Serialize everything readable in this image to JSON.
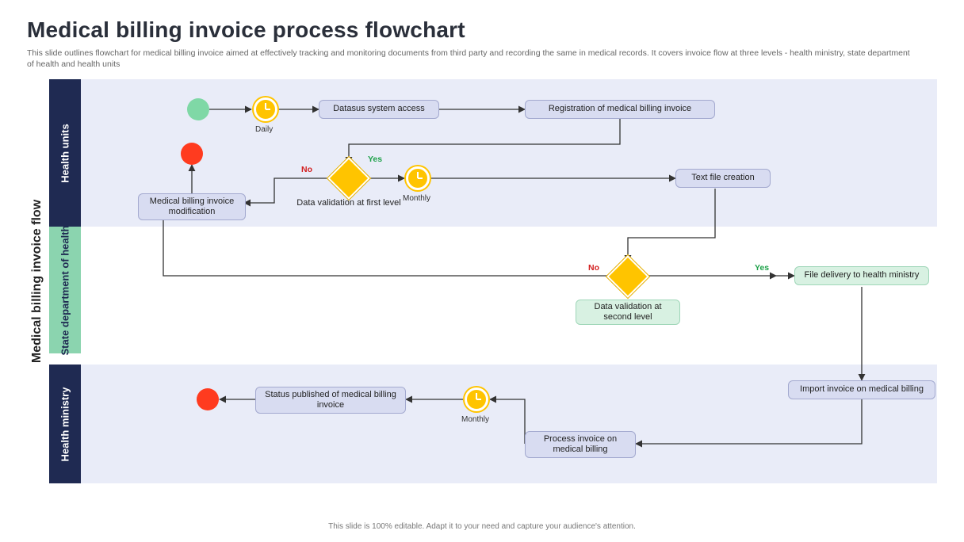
{
  "title": "Medical billing invoice process flowchart",
  "subtitle": "This slide outlines flowchart for medical billing invoice aimed at effectively tracking and monitoring documents from third party and recording the same in medical records. It covers invoice flow at three levels -  health ministry, state department of health and health units",
  "footer": "This slide is 100% editable. Adapt it to your need and capture your audience's attention.",
  "ylabel": "Medical billing invoice flow",
  "lanes": {
    "health_units": "Health units",
    "state_dept": "State department of health",
    "ministry": "Health ministry"
  },
  "nodes": {
    "datasus": "Datasus  system  access",
    "registration": "Registration  of medical billing invoice",
    "modification": "Medical billing invoice modification",
    "validation1": "Data validation at first level",
    "textfile": "Text file creation",
    "validation2": "Data validation at second  level",
    "file_delivery": "File delivery to health ministry",
    "import_invoice": "Import invoice on medical billing",
    "process_invoice": "Process  invoice on medical billing",
    "status_pub": "Status published of medical billing invoice"
  },
  "clocks": {
    "daily": "Daily",
    "monthly": "Monthly",
    "monthly2": "Monthly"
  },
  "edges": {
    "yes": "Yes",
    "no": "No"
  },
  "chart_data": {
    "type": "flowchart-swimlane",
    "title": "Medical billing invoice process flowchart",
    "swimlanes": [
      "Health units",
      "State department of health",
      "Health ministry"
    ],
    "nodes": [
      {
        "id": "start",
        "type": "start",
        "lane": "Health units"
      },
      {
        "id": "clock_daily",
        "type": "timer",
        "label": "Daily",
        "lane": "Health units"
      },
      {
        "id": "datasus",
        "type": "process",
        "label": "Datasus system access",
        "lane": "Health units"
      },
      {
        "id": "registration",
        "type": "process",
        "label": "Registration of medical billing invoice",
        "lane": "Health units"
      },
      {
        "id": "validation1",
        "type": "decision",
        "label": "Data validation at first level",
        "lane": "Health units"
      },
      {
        "id": "modification",
        "type": "process",
        "label": "Medical billing invoice modification",
        "lane": "Health units"
      },
      {
        "id": "end1",
        "type": "end",
        "lane": "Health units"
      },
      {
        "id": "clock_monthly",
        "type": "timer",
        "label": "Monthly",
        "lane": "Health units"
      },
      {
        "id": "textfile",
        "type": "process",
        "label": "Text file creation",
        "lane": "Health units"
      },
      {
        "id": "validation2",
        "type": "decision",
        "label": "Data validation at second level",
        "lane": "State department of health"
      },
      {
        "id": "file_delivery",
        "type": "process",
        "label": "File delivery to health ministry",
        "lane": "State department of health"
      },
      {
        "id": "import_invoice",
        "type": "process",
        "label": "Import invoice on medical billing",
        "lane": "Health ministry"
      },
      {
        "id": "process_invoice",
        "type": "process",
        "label": "Process invoice on medical billing",
        "lane": "Health ministry"
      },
      {
        "id": "clock_monthly2",
        "type": "timer",
        "label": "Monthly",
        "lane": "Health ministry"
      },
      {
        "id": "status_pub",
        "type": "process",
        "label": "Status published of medical billing invoice",
        "lane": "Health ministry"
      },
      {
        "id": "end2",
        "type": "end",
        "lane": "Health ministry"
      }
    ],
    "edges": [
      {
        "from": "start",
        "to": "clock_daily"
      },
      {
        "from": "clock_daily",
        "to": "datasus"
      },
      {
        "from": "datasus",
        "to": "registration"
      },
      {
        "from": "registration",
        "to": "validation1"
      },
      {
        "from": "validation1",
        "to": "clock_monthly",
        "label": "Yes"
      },
      {
        "from": "validation1",
        "to": "modification",
        "label": "No"
      },
      {
        "from": "modification",
        "to": "end1"
      },
      {
        "from": "clock_monthly",
        "to": "textfile"
      },
      {
        "from": "textfile",
        "to": "validation2"
      },
      {
        "from": "validation2",
        "to": "file_delivery",
        "label": "Yes"
      },
      {
        "from": "validation2",
        "to": "modification",
        "label": "No"
      },
      {
        "from": "file_delivery",
        "to": "import_invoice"
      },
      {
        "from": "import_invoice",
        "to": "process_invoice"
      },
      {
        "from": "process_invoice",
        "to": "clock_monthly2"
      },
      {
        "from": "clock_monthly2",
        "to": "status_pub"
      },
      {
        "from": "status_pub",
        "to": "end2"
      }
    ]
  }
}
